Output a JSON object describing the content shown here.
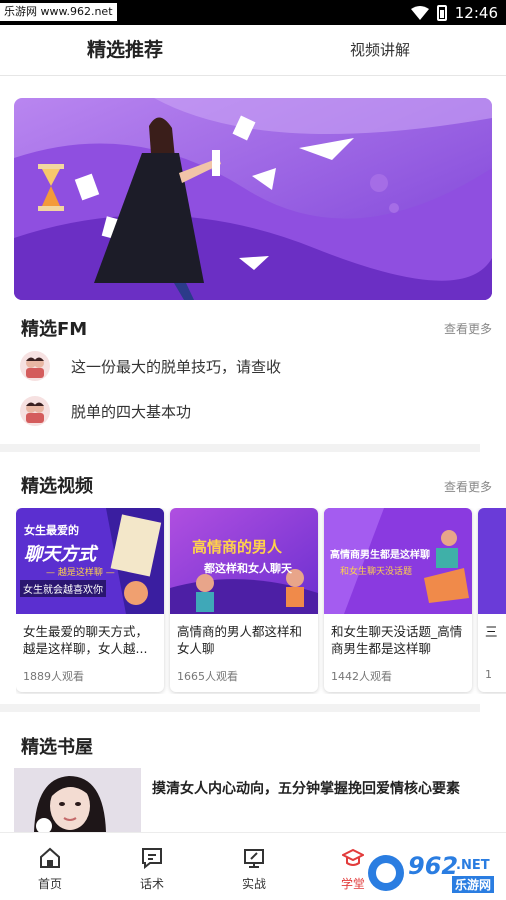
{
  "status_bar": {
    "watermark": "乐游网 www.962.net",
    "time": "12:46"
  },
  "tabs": [
    {
      "label": "精选推荐",
      "active": true
    },
    {
      "label": "视频讲解",
      "active": false
    }
  ],
  "fm": {
    "title": "精选FM",
    "more": "查看更多",
    "items": [
      {
        "text": "这一份最大的脱单技巧，请查收"
      },
      {
        "text": "脱单的四大基本功"
      }
    ]
  },
  "videos": {
    "title": "精选视频",
    "more": "查看更多",
    "items": [
      {
        "thumb_text_1": "女生最爱的",
        "thumb_text_2": "聊天方式",
        "thumb_text_3": "— 越是这样聊 —",
        "thumb_text_4": "女生就会越喜欢你",
        "title": "女生最爱的聊天方式，越是这样聊，女人越...",
        "views": "1889人观看"
      },
      {
        "thumb_text_1": "高情商的男人",
        "thumb_text_2": "都这样和女人聊天",
        "title": "高情商的男人都这样和女人聊",
        "views": "1665人观看"
      },
      {
        "thumb_text_1": "高情商男生都是这样聊",
        "thumb_text_2": "和女生聊天没话题",
        "title": "和女生聊天没话题_高情商男生都是这样聊",
        "views": "1442人观看"
      },
      {
        "title": "三",
        "views": "1"
      }
    ]
  },
  "books": {
    "title": "精选书屋",
    "items": [
      {
        "title": "摸清女人内心动向，五分钟掌握挽回爱情核心要素"
      }
    ]
  },
  "bottom_nav": [
    {
      "label": "首页",
      "icon": "home-icon",
      "active": false
    },
    {
      "label": "话术",
      "icon": "chat-icon",
      "active": false
    },
    {
      "label": "实战",
      "icon": "monitor-icon",
      "active": false
    },
    {
      "label": "学堂",
      "icon": "graduation-cap-icon",
      "active": true
    }
  ],
  "overlay_logo": {
    "text": "962",
    "suffix": ".NET",
    "caption": "乐游网"
  },
  "colors": {
    "accent": "#e23c3c",
    "banner_purple": "#8b4fd9",
    "card_purple": "#6a3bd8"
  }
}
